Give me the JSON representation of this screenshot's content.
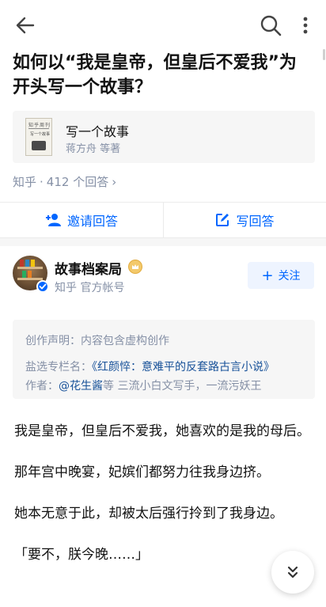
{
  "question": {
    "title": "如何以“我是皇帝，但皇后不爱我”为开头写一个故事？"
  },
  "book_card": {
    "cover_text": "知乎周刊",
    "cover_subtitle": "写一个故事",
    "title": "写一个故事",
    "author": "蒋方舟 等著"
  },
  "meta": {
    "source": "知乎",
    "separator": "·",
    "answer_count": "412 个回答"
  },
  "actions": {
    "invite_label": "邀请回答",
    "write_label": "写回答"
  },
  "author": {
    "name": "故事档案局",
    "subtitle": "知乎 官方帐号",
    "follow_label": "关注"
  },
  "notice": {
    "declaration": "创作声明：内容包含虚构创作",
    "column_prefix": "盐选专栏名：",
    "column_name": "《红颜悴：意难平的反套路古言小说》",
    "author_prefix": "作者：",
    "author_link": "@花生酱",
    "author_suffix": "等 三流小白文写手，一流污妖王"
  },
  "answer": {
    "paragraphs": [
      "我是皇帝，但皇后不爱我，她喜欢的是我的母后。",
      "那年宫中晚宴，妃嫔们都努力往我身边挤。",
      "她本无意于此，却被太后强行拎到了我身边。",
      "「要不，朕今晚……」"
    ]
  },
  "colors": {
    "accent": "#0066ff",
    "secondary_text": "#8590a6",
    "link": "#175199"
  }
}
